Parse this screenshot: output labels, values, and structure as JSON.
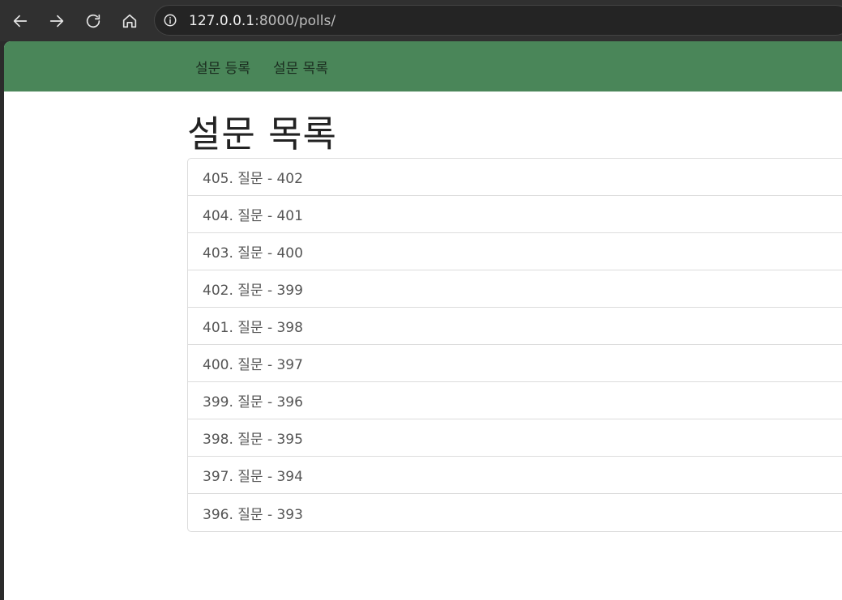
{
  "browser": {
    "url_host": "127.0.0.1",
    "url_rest": ":8000/polls/"
  },
  "navbar": {
    "links": [
      {
        "label": "설문 등록"
      },
      {
        "label": "설문 목록"
      }
    ]
  },
  "main": {
    "title": "설문 목록",
    "items": [
      {
        "label": "405. 질문 - 402"
      },
      {
        "label": "404. 질문 - 401"
      },
      {
        "label": "403. 질문 - 400"
      },
      {
        "label": "402. 질문 - 399"
      },
      {
        "label": "401. 질문 - 398"
      },
      {
        "label": "400. 질문 - 397"
      },
      {
        "label": "399. 질문 - 396"
      },
      {
        "label": "398. 질문 - 395"
      },
      {
        "label": "397. 질문 - 394"
      },
      {
        "label": "396. 질문 - 393"
      }
    ]
  },
  "colors": {
    "navbar_bg": "#4a8659",
    "chrome_bg": "#303030"
  }
}
